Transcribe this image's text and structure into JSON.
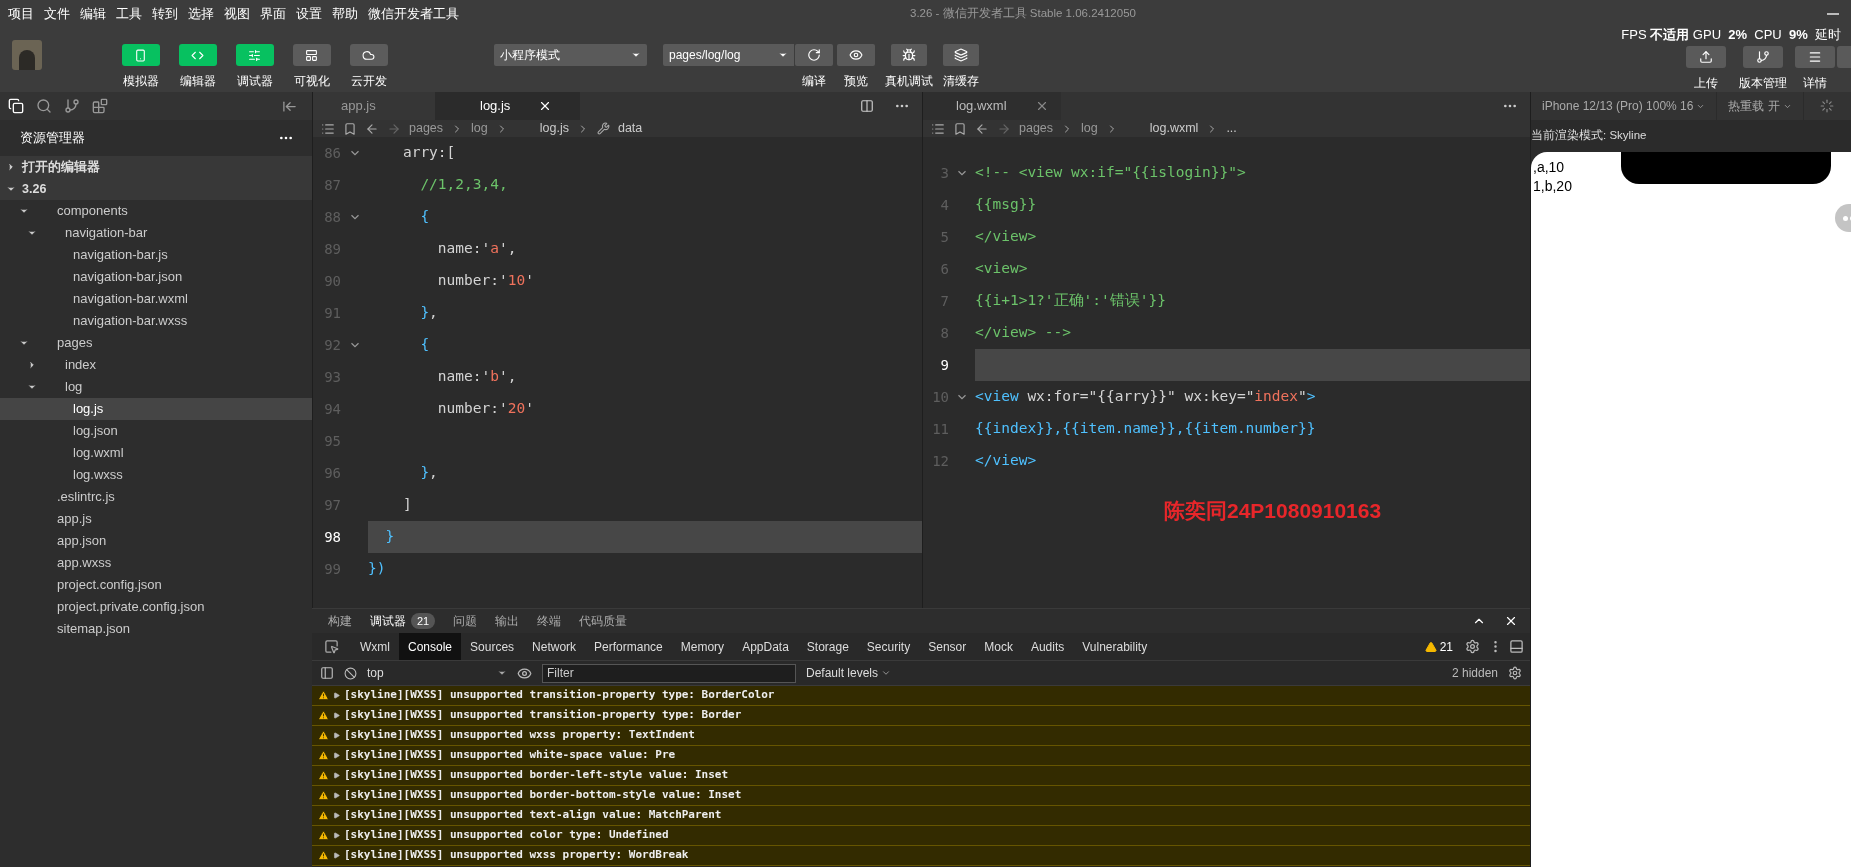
{
  "menu_bar": {
    "items": [
      "项目",
      "文件",
      "编辑",
      "工具",
      "转到",
      "选择",
      "视图",
      "界面",
      "设置",
      "帮助",
      "微信开发者工具"
    ],
    "title": "3.26 - 微信开发者工具 Stable 1.06.2412050"
  },
  "toolbar": {
    "view_buttons": [
      {
        "label": "模拟器",
        "on": true
      },
      {
        "label": "编辑器",
        "on": true
      },
      {
        "label": "调试器",
        "on": true
      },
      {
        "label": "可视化",
        "on": false
      },
      {
        "label": "云开发",
        "on": false
      }
    ],
    "mode_select": "小程序模式",
    "page_select": "pages/log/log",
    "actions": [
      "编译",
      "预览",
      "真机调试",
      "清缓存"
    ],
    "stats": "FPS **不适用** GPU  **2%**  CPU  **9%**  延时",
    "right_buttons": [
      "上传",
      "版本管理",
      "详情"
    ]
  },
  "sidebar": {
    "title": "资源管理器",
    "sections": [
      {
        "label": "打开的编辑器",
        "expanded": false
      },
      {
        "label": "3.26",
        "expanded": true
      }
    ],
    "tree": [
      {
        "name": "components",
        "expanded": true,
        "selected": false,
        "children": [
          {
            "name": "navigation-bar",
            "expanded": true,
            "selected": false,
            "children": [
              {
                "name": "navigation-bar.js",
                "selected": false
              },
              {
                "name": "navigation-bar.json",
                "selected": false
              },
              {
                "name": "navigation-bar.wxml",
                "selected": false
              },
              {
                "name": "navigation-bar.wxss",
                "selected": false
              }
            ]
          }
        ]
      },
      {
        "name": "pages",
        "expanded": true,
        "selected": false,
        "children": [
          {
            "name": "index",
            "expanded": false,
            "selected": false
          },
          {
            "name": "log",
            "expanded": true,
            "selected": false,
            "children": [
              {
                "name": "log.js",
                "selected": true
              },
              {
                "name": "log.json",
                "selected": false
              },
              {
                "name": "log.wxml",
                "selected": false
              },
              {
                "name": "log.wxss",
                "selected": false
              }
            ]
          }
        ]
      },
      {
        "name": ".eslintrc.js",
        "selected": false
      },
      {
        "name": "app.js",
        "selected": false
      },
      {
        "name": "app.json",
        "selected": false
      },
      {
        "name": "app.wxss",
        "selected": false
      },
      {
        "name": "project.config.json",
        "selected": false
      },
      {
        "name": "project.private.config.json",
        "selected": false
      },
      {
        "name": "sitemap.json",
        "selected": false
      }
    ]
  },
  "editors": [
    {
      "tabs": [
        {
          "label": "app.js",
          "selected": false
        },
        {
          "label": "log.js",
          "selected": true
        }
      ],
      "breadcrumb": [
        "pages",
        "log",
        "log.js",
        "data"
      ],
      "lines": [
        {
          "number": "86",
          "fold": true,
          "current": false,
          "tokens": [
            {
              "kind": "plain",
              "text": "    arry:["
            }
          ]
        },
        {
          "number": "87",
          "fold": false,
          "current": false,
          "tokens": [
            {
              "kind": "comment",
              "text": "      //1,2,3,4,"
            }
          ]
        },
        {
          "number": "88",
          "fold": true,
          "current": false,
          "tokens": [
            {
              "kind": "bracket",
              "text": "      {"
            }
          ]
        },
        {
          "number": "89",
          "fold": false,
          "current": false,
          "tokens": [
            {
              "kind": "plain",
              "text": "        name:'"
            },
            {
              "kind": "string",
              "text": "a"
            },
            {
              "kind": "plain",
              "text": "',"
            }
          ]
        },
        {
          "number": "90",
          "fold": false,
          "current": false,
          "tokens": [
            {
              "kind": "plain",
              "text": "        number:'"
            },
            {
              "kind": "string",
              "text": "10"
            },
            {
              "kind": "plain",
              "text": "'"
            }
          ]
        },
        {
          "number": "91",
          "fold": false,
          "current": false,
          "tokens": [
            {
              "kind": "bracket",
              "text": "      }"
            },
            {
              "kind": "plain",
              "text": ","
            }
          ]
        },
        {
          "number": "92",
          "fold": true,
          "current": false,
          "tokens": [
            {
              "kind": "bracket",
              "text": "      {"
            }
          ]
        },
        {
          "number": "93",
          "fold": false,
          "current": false,
          "tokens": [
            {
              "kind": "plain",
              "text": "        name:'"
            },
            {
              "kind": "string",
              "text": "b"
            },
            {
              "kind": "plain",
              "text": "',"
            }
          ]
        },
        {
          "number": "94",
          "fold": false,
          "current": false,
          "tokens": [
            {
              "kind": "plain",
              "text": "        number:'"
            },
            {
              "kind": "string",
              "text": "20"
            },
            {
              "kind": "plain",
              "text": "'"
            }
          ]
        },
        {
          "number": "95",
          "fold": false,
          "current": false
        },
        {
          "number": "96",
          "fold": false,
          "current": false,
          "tokens": [
            {
              "kind": "bracket",
              "text": "      }"
            },
            {
              "kind": "plain",
              "text": ","
            }
          ]
        },
        {
          "number": "97",
          "fold": false,
          "current": false,
          "tokens": [
            {
              "kind": "plain",
              "text": "    ]"
            }
          ]
        },
        {
          "number": "98",
          "fold": false,
          "current": true,
          "tokens": [
            {
              "kind": "bracket",
              "text": "  }"
            }
          ]
        },
        {
          "number": "99",
          "fold": false,
          "current": false,
          "tokens": [
            {
              "kind": "bracket",
              "text": "})"
            }
          ]
        }
      ]
    },
    {
      "tabs": [
        {
          "label": "log.wxml",
          "selected": true
        }
      ],
      "breadcrumb": [
        "pages",
        "log",
        "log.wxml",
        "..."
      ],
      "lines": [
        {
          "number": "3",
          "fold": true,
          "current": false,
          "tokens": [
            {
              "kind": "comment",
              "text": "<!-- <view wx:if=\"{{islogin}}\">"
            }
          ]
        },
        {
          "number": "4",
          "fold": false,
          "current": false,
          "tokens": [
            {
              "kind": "comment",
              "text": "{{msg}}"
            }
          ]
        },
        {
          "number": "5",
          "fold": false,
          "current": false,
          "tokens": [
            {
              "kind": "comment",
              "text": "</view>"
            }
          ]
        },
        {
          "number": "6",
          "fold": false,
          "current": false,
          "tokens": [
            {
              "kind": "comment",
              "text": "<view>"
            }
          ]
        },
        {
          "number": "7",
          "fold": false,
          "current": false,
          "tokens": [
            {
              "kind": "comment",
              "text": "{{i+1>1?'正确':'错误'}}"
            }
          ]
        },
        {
          "number": "8",
          "fold": false,
          "current": false,
          "tokens": [
            {
              "kind": "comment",
              "text": "</view> -->"
            }
          ]
        },
        {
          "number": "9",
          "fold": false,
          "current": true
        },
        {
          "number": "10",
          "fold": true,
          "current": false,
          "tokens": [
            {
              "kind": "bracket",
              "text": "<view"
            },
            {
              "kind": "plain",
              "text": " wx:for=\"{{arry}}\" wx:key=\""
            },
            {
              "kind": "string",
              "text": "index"
            },
            {
              "kind": "plain",
              "text": "\""
            },
            {
              "kind": "bracket",
              "text": ">"
            }
          ]
        },
        {
          "number": "11",
          "fold": false,
          "current": false,
          "tokens": [
            {
              "kind": "bracket",
              "text": "{{index}},{{item.name}},{{item.number}}"
            }
          ]
        },
        {
          "number": "12",
          "fold": false,
          "current": false,
          "tokens": [
            {
              "kind": "bracket",
              "text": "</view>"
            }
          ]
        }
      ],
      "stamp": "陈奕同24P1080910163"
    }
  ],
  "console": {
    "panel_tabs": [
      {
        "label": "构建",
        "selected": false
      },
      {
        "label": "调试器",
        "selected": true,
        "badge": "21"
      },
      {
        "label": "问题",
        "selected": false
      },
      {
        "label": "输出",
        "selected": false
      },
      {
        "label": "终端",
        "selected": false
      },
      {
        "label": "代码质量",
        "selected": false
      }
    ],
    "devtools_tabs": [
      {
        "label": "Wxml",
        "selected": false
      },
      {
        "label": "Console",
        "selected": true
      },
      {
        "label": "Sources",
        "selected": false
      },
      {
        "label": "Network",
        "selected": false
      },
      {
        "label": "Performance",
        "selected": false
      },
      {
        "label": "Memory",
        "selected": false
      },
      {
        "label": "AppData",
        "selected": false
      },
      {
        "label": "Storage",
        "selected": false
      },
      {
        "label": "Security",
        "selected": false
      },
      {
        "label": "Sensor",
        "selected": false
      },
      {
        "label": "Mock",
        "selected": false
      },
      {
        "label": "Audits",
        "selected": false
      },
      {
        "label": "Vulnerability",
        "selected": false
      }
    ],
    "warning_count": "21",
    "context": "top",
    "filter_placeholder": "Filter",
    "levels": "Default levels",
    "hidden": "2 hidden",
    "messages": [
      {
        "text": "[skyline][WXSS] unsupported transition-property type: BorderColor"
      },
      {
        "text": "[skyline][WXSS] unsupported transition-property type: Border"
      },
      {
        "text": "[skyline][WXSS] unsupported wxss property: TextIndent"
      },
      {
        "text": "[skyline][WXSS] unsupported white-space value: Pre"
      },
      {
        "text": "[skyline][WXSS] unsupported border-left-style value: Inset"
      },
      {
        "text": "[skyline][WXSS] unsupported border-bottom-style value: Inset"
      },
      {
        "text": "[skyline][WXSS] unsupported text-align value: MatchParent"
      },
      {
        "text": "[skyline][WXSS] unsupported color type: Undefined"
      },
      {
        "text": "[skyline][WXSS] unsupported wxss property: WordBreak"
      }
    ]
  },
  "simulator": {
    "device": "iPhone 12/13 (Pro) 100% 16",
    "hot_reload": "热重载 开",
    "render_mode": "当前渲染模式: Skyline",
    "output": [
      ",a,10",
      "1,b,20"
    ]
  }
}
